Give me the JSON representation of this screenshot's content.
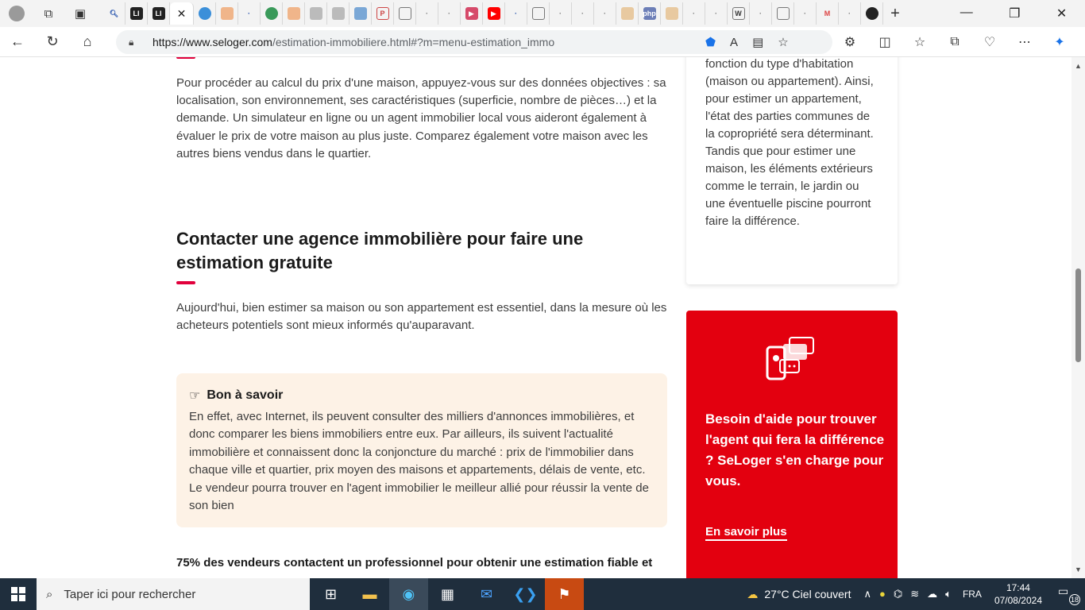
{
  "browser": {
    "tabs_active_close": "✕",
    "new_tab": "+",
    "url_host": "https://www.seloger.com",
    "url_path": "/estimation-immobiliere.html#?m=menu-estimation_immo",
    "window_controls": [
      "—",
      "❐",
      "✕"
    ]
  },
  "article": {
    "para1": "Pour procéder au calcul du prix d'une maison, appuyez-vous sur des données objectives : sa localisation, son environnement, ses caractéristiques (superficie, nombre de pièces…) et la demande. Un simulateur en ligne ou un agent immobilier local vous aideront également à évaluer le prix de votre maison au plus juste. Comparez également votre maison avec les autres biens vendus dans le quartier.",
    "heading": "Contacter une agence immobilière pour faire une estimation gratuite",
    "para2": "Aujourd'hui, bien estimer sa maison ou son appartement est essentiel, dans la mesure où les acheteurs potentiels sont mieux informés qu'auparavant.",
    "tip_title": "Bon à savoir",
    "tip_body": "En effet, avec Internet, ils peuvent consulter des milliers d'annonces immobilières, et donc comparer les biens immobiliers entre eux. Par ailleurs, ils suivent l'actualité immobilière et connaissent donc la conjoncture du marché : prix de l'immobilier dans chaque ville et quartier, prix moyen des maisons et appartements, délais de vente, etc. Le vendeur pourra trouver en l'agent immobilier le meilleur allié pour réussir la vente de son bien",
    "bold_line": "75% des vendeurs contactent un professionnel pour obtenir une estimation fiable et"
  },
  "sidebar": {
    "card_text": "fonction du type d'habitation (maison ou appartement). Ainsi, pour estimer un appartement, l'état des parties communes de la copropriété sera déterminant. Tandis que pour estimer une maison, les éléments extérieurs comme le terrain, le jardin ou une éventuelle piscine pourront faire la différence.",
    "promo_text": "Besoin d'aide pour trouver l'agent qui fera la différence ? SeLoger s'en charge pour vous.",
    "promo_link": "En savoir plus"
  },
  "taskbar": {
    "search_placeholder": "Taper ici pour rechercher",
    "weather": "27°C  Ciel couvert",
    "lang": "FRA",
    "time": "17:44",
    "date": "07/08/2024",
    "notif_count": "18"
  },
  "colors": {
    "accent_red": "#e3000f",
    "tip_bg": "#fdf2e6"
  }
}
